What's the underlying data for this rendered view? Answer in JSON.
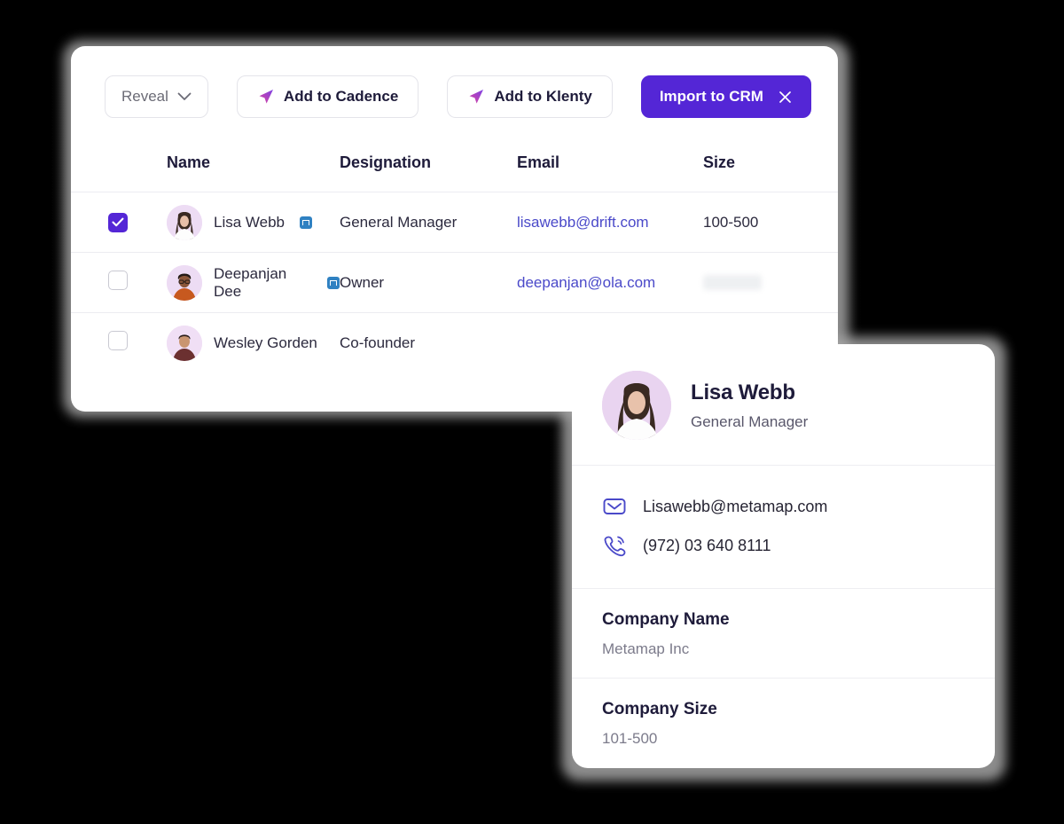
{
  "toolbar": {
    "reveal_label": "Reveal",
    "reveal_icon": "chevron-down-icon",
    "add_to_cadence_label": "Add to Cadence",
    "add_to_klenty_label": "Add to Klenty",
    "send_icon": "paper-plane-icon",
    "import_label": "Import to CRM",
    "import_close_icon": "close-icon",
    "primary_color": "#5426d6",
    "plane_gradient": [
      "#e0479e",
      "#7b3fe4"
    ]
  },
  "table": {
    "columns": [
      "",
      "Name",
      "Designation",
      "Email",
      "Size"
    ],
    "rows": [
      {
        "selected": true,
        "name": "Lisa Webb",
        "has_linkedin_badge": true,
        "designation": "General Manager",
        "email": "lisawebb@drift.com",
        "size": "100-500",
        "size_redacted": false
      },
      {
        "selected": false,
        "name": "Deepanjan Dee",
        "has_linkedin_badge": true,
        "designation": "Owner",
        "email": "deepanjan@ola.com",
        "size": "",
        "size_redacted": true
      },
      {
        "selected": false,
        "name": "Wesley Gorden",
        "has_linkedin_badge": false,
        "designation": "Co-founder",
        "email": "",
        "size": "",
        "size_redacted": false
      }
    ]
  },
  "detail_card": {
    "name": "Lisa Webb",
    "role": "General Manager",
    "email": "Lisawebb@metamap.com",
    "email_icon": "envelope-icon",
    "phone": "(972) 03 640 8111",
    "phone_icon": "phone-ring-icon",
    "fields": [
      {
        "label": "Company Name",
        "value": "Metamap Inc"
      },
      {
        "label": "Company Size",
        "value": "101-500"
      }
    ],
    "icon_color": "#4a49c9"
  }
}
